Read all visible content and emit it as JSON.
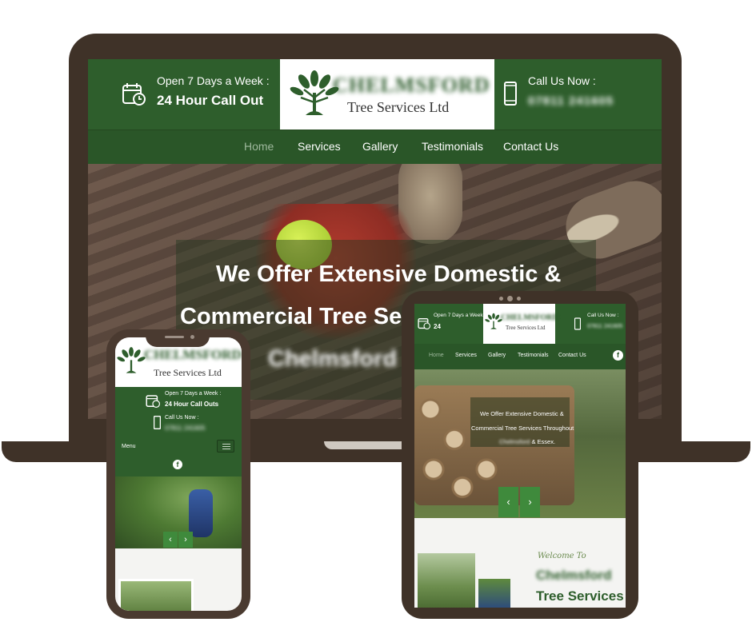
{
  "laptop": {
    "header": {
      "open_label": "Open 7 Days a Week :",
      "callout": "24 Hour Call Out",
      "brand": "CHELMSFORD",
      "brand_sub": "Tree Services Ltd",
      "callnow_label": "Call Us Now :",
      "phone_number": "07811 241605"
    },
    "nav": [
      "Home",
      "Services",
      "Gallery",
      "Testimonials",
      "Contact Us"
    ],
    "hero": {
      "line1": "We Offer Extensive Domestic &",
      "line2": "Commercial Tree Se",
      "line3": "Chelmsford"
    }
  },
  "phone": {
    "brand": "CHELMSFORD",
    "brand_sub": "Tree Services Ltd",
    "open_label": "Open 7 Days a Week :",
    "callout": "24 Hour Call Outs",
    "callnow_label": "Call Us Now :",
    "phone_number": "07811 241605",
    "menu_label": "Menu",
    "facebook_glyph": "f",
    "prev_glyph": "‹",
    "next_glyph": "›"
  },
  "tablet": {
    "open_label": "Open 7 Days a Week :",
    "callout": "24",
    "brand": "CHELMSFORD",
    "brand_sub": "Tree Services Ltd",
    "callnow_label": "Call Us Now :",
    "phone_number": "07811 241605",
    "nav": [
      "Home",
      "Services",
      "Gallery",
      "Testimonials",
      "Contact Us"
    ],
    "facebook_glyph": "f",
    "hero": {
      "line1": "We Offer Extensive Domestic &",
      "line2": "Commercial Tree Services Throughout",
      "line3_blur": "Chelmsford",
      "line3": "& Essex."
    },
    "prev_glyph": "‹",
    "next_glyph": "›",
    "welcome": "Welcome To",
    "title1": "Chelmsford",
    "title2": "Tree Services"
  },
  "colors": {
    "brand_green": "#2e5e2c",
    "nav_green": "#2a5628",
    "device_frame": "#3f3228",
    "arrow_green": "#3f8a3c"
  }
}
